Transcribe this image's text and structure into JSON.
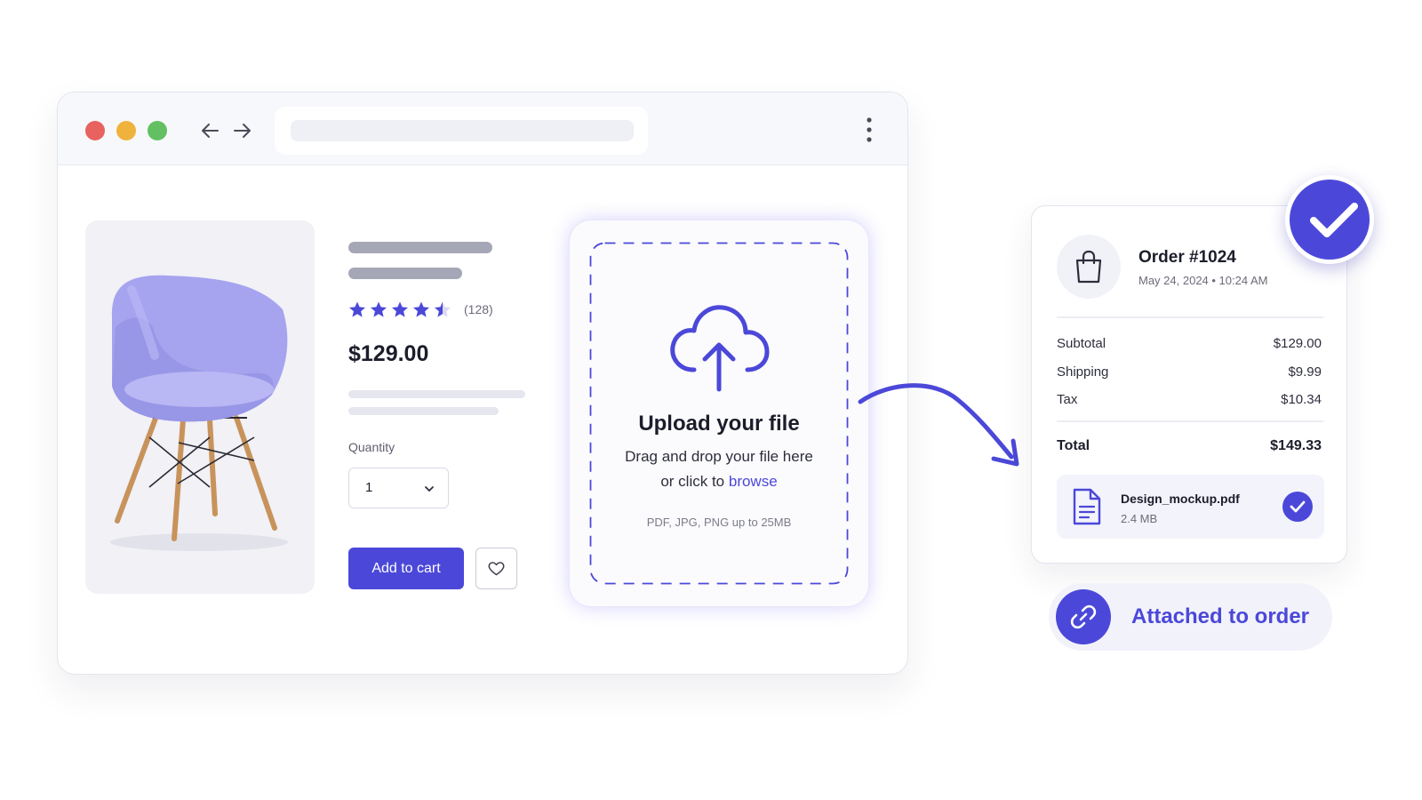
{
  "browser": {
    "controls": [
      "close",
      "minimize",
      "maximize"
    ],
    "nav_icons": [
      "arrow-left-icon",
      "arrow-right-icon"
    ],
    "menu_icon": "kebab-menu-icon"
  },
  "product": {
    "rating": 4.5,
    "rating_max": 5,
    "review_count": "(128)",
    "price": "$129.00",
    "quantity_label": "Quantity",
    "quantity_value": "1",
    "add_to_cart": "Add to cart",
    "wishlist_icon": "heart-icon"
  },
  "upload": {
    "title": "Upload your file",
    "line1": "Drag and drop your file here",
    "line2_prefix": "or click to ",
    "line2_link": "browse",
    "hint": "PDF, JPG, PNG up to 25MB",
    "icon": "cloud-upload-icon"
  },
  "order": {
    "title": "Order #1024",
    "date": "May 24, 2024 • 10:24 AM",
    "rows": [
      {
        "label": "Subtotal",
        "value": "$129.00"
      },
      {
        "label": "Shipping",
        "value": "$9.99"
      },
      {
        "label": "Tax",
        "value": "$10.34"
      }
    ],
    "total_label": "Total",
    "total_value": "$149.33",
    "file": {
      "name": "Design_mockup.pdf",
      "size": "2.4 MB"
    }
  },
  "attached": {
    "label": "Attached to order",
    "icon": "link-icon"
  },
  "colors": {
    "accent": "#4b48d9",
    "star": "#4b48d9",
    "chair": "#a6a4ef"
  }
}
